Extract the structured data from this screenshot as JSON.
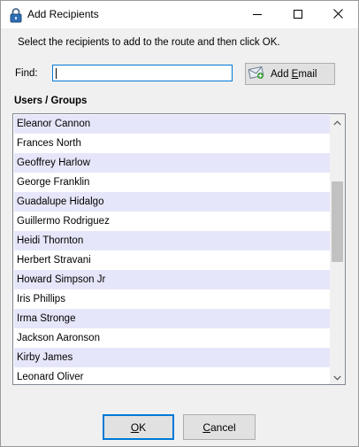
{
  "window": {
    "title": "Add Recipients",
    "controls": [
      "minimize",
      "maximize",
      "close"
    ]
  },
  "instruction": "Select the recipients to add to the route and then click OK.",
  "find": {
    "label": "Find:",
    "value": "",
    "placeholder": ""
  },
  "add_email": {
    "label_prefix": "Add ",
    "label_mnemonic": "E",
    "label_rest": "mail",
    "icon": "envelope-icon"
  },
  "users_groups": {
    "label": "Users / Groups",
    "items": [
      "Eleanor Cannon",
      "Frances North",
      "Geoffrey Harlow",
      "George Franklin",
      "Guadalupe Hidalgo",
      "Guillermo Rodriguez",
      "Heidi Thornton",
      "Herbert Stravani",
      "Howard Simpson Jr",
      "Iris Phillips",
      "Irma Stronge",
      "Jackson Aaronson",
      "Kirby James",
      "Leonard Oliver"
    ],
    "alt_row_color": "#e6e6fa"
  },
  "buttons": {
    "ok_mnemonic": "O",
    "ok_rest": "K",
    "cancel_mnemonic": "C",
    "cancel_rest": "ancel"
  },
  "colors": {
    "accent": "#0078d7",
    "dialog_bg": "#f0f0f0",
    "button_bg": "#e1e1e1"
  }
}
